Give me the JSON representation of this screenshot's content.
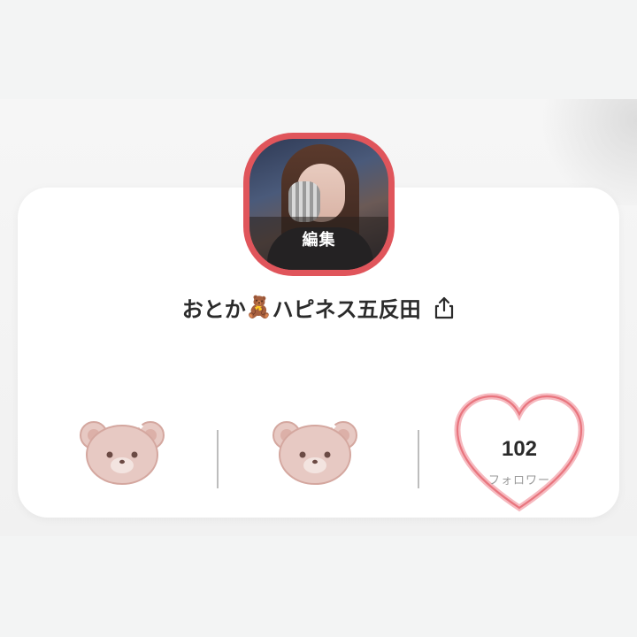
{
  "avatar": {
    "edit_label": "編集"
  },
  "profile": {
    "name_before": "おとか",
    "name_emoji": "🧸",
    "name_after": "ハピネス五反田"
  },
  "stats": {
    "followers_count": "102",
    "followers_label": "フォロワー"
  },
  "colors": {
    "avatar_border": "#e0555b",
    "heart_outline": "#e8757e",
    "bear": "#e7c9c3"
  },
  "icons": [
    "share-icon",
    "bear-icon",
    "heart-icon",
    "teddy-bear-emoji"
  ]
}
